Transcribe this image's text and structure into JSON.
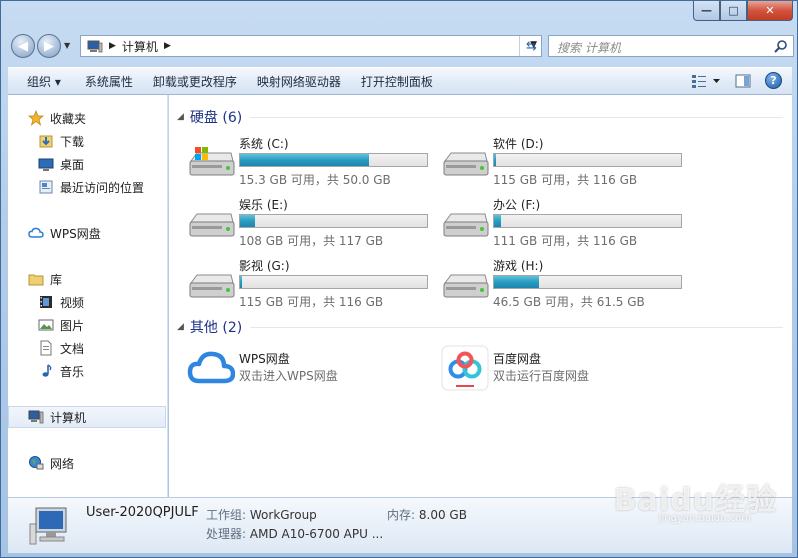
{
  "window": {
    "caption": {
      "minimize": "—",
      "maximize": "□",
      "close": "✕"
    }
  },
  "nav": {
    "breadcrumb": "计算机",
    "search_placeholder": "搜索 计算机"
  },
  "toolbar": {
    "items": [
      "组织",
      "系统属性",
      "卸载或更改程序",
      "映射网络驱动器",
      "打开控制面板"
    ]
  },
  "sidebar": {
    "favorites": {
      "label": "收藏夹",
      "items": [
        "下载",
        "桌面",
        "最近访问的位置"
      ]
    },
    "wps": "WPS网盘",
    "libraries": {
      "label": "库",
      "items": [
        "视频",
        "图片",
        "文档",
        "音乐"
      ]
    },
    "computer": "计算机",
    "network": "网络"
  },
  "groups": {
    "drives_header": "硬盘 (6)",
    "other_header": "其他 (2)"
  },
  "drives": [
    {
      "name": "系统 (C:)",
      "caption": "15.3 GB 可用，共 50.0 GB",
      "used_fraction": 0.69,
      "icon": "windows-drive-icon"
    },
    {
      "name": "软件 (D:)",
      "caption": "115 GB 可用，共 116 GB",
      "used_fraction": 0.01,
      "icon": "hard-drive-icon"
    },
    {
      "name": "娱乐 (E:)",
      "caption": "108 GB 可用，共 117 GB",
      "used_fraction": 0.08,
      "icon": "hard-drive-icon"
    },
    {
      "name": "办公 (F:)",
      "caption": "111 GB 可用，共 116 GB",
      "used_fraction": 0.04,
      "icon": "hard-drive-icon"
    },
    {
      "name": "影视 (G:)",
      "caption": "115 GB 可用，共 116 GB",
      "used_fraction": 0.01,
      "icon": "hard-drive-icon"
    },
    {
      "name": "游戏 (H:)",
      "caption": "46.5 GB 可用，共 61.5 GB",
      "used_fraction": 0.24,
      "icon": "hard-drive-icon"
    }
  ],
  "others": [
    {
      "name": "WPS网盘",
      "desc": "双击进入WPS网盘",
      "icon": "wps-cloud-icon"
    },
    {
      "name": "百度网盘",
      "desc": "双击运行百度网盘",
      "icon": "baidu-netdisk-icon"
    }
  ],
  "details": {
    "computer_name": "User-2020QPJULF",
    "workgroup_key": "工作组:",
    "workgroup_val": "WorkGroup",
    "memory_key": "内存:",
    "memory_val": "8.00 GB",
    "cpu_key": "处理器:",
    "cpu_val": "AMD A10-6700 APU ..."
  },
  "watermark": {
    "main": "Baidu经验",
    "sub": "jingyan.baidu.com"
  },
  "colors": {
    "accent": "#1e3287",
    "bar_fill": "#2b9bc1"
  }
}
